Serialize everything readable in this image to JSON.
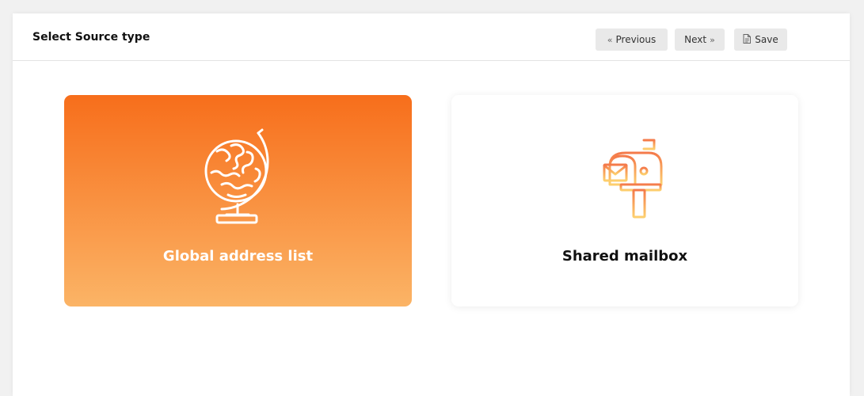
{
  "header": {
    "title": "Select Source type"
  },
  "toolbar": {
    "previous_label": "Previous",
    "previous_icon": "chevron-double-left-icon",
    "next_label": "Next",
    "next_icon": "chevron-double-right-icon",
    "save_label": "Save",
    "save_icon": "document-icon"
  },
  "options": [
    {
      "label": "Global address list",
      "icon": "globe-icon",
      "selected": true
    },
    {
      "label": "Shared mailbox",
      "icon": "mailbox-icon",
      "selected": false
    }
  ],
  "colors": {
    "accent_top": "#f76e1b",
    "accent_bottom": "#fbb466",
    "icon_gradient_start": "#f47a4a",
    "icon_gradient_end": "#fdcf6e"
  }
}
